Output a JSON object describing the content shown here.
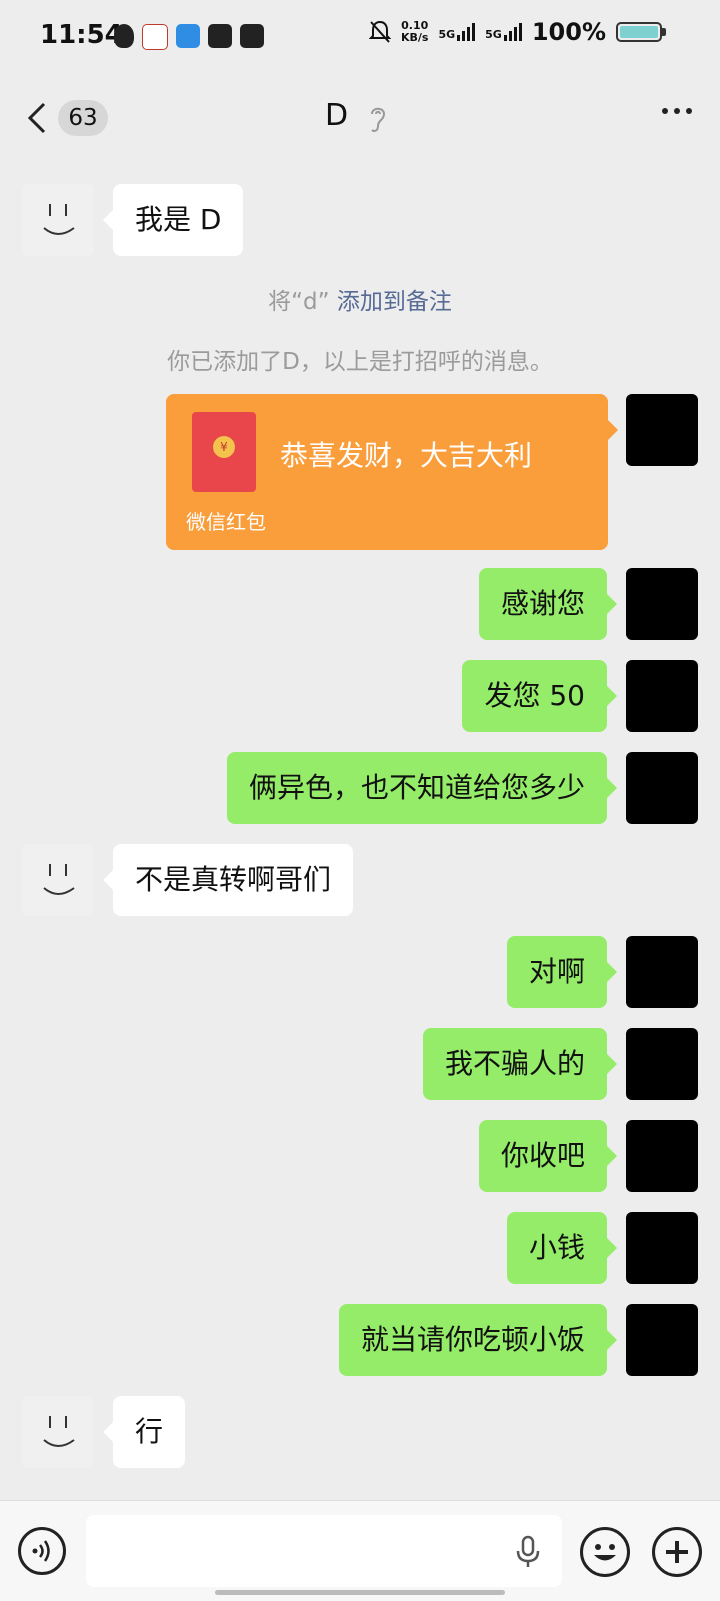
{
  "status_bar": {
    "time": "11:54",
    "net_speed_value": "0.10",
    "net_speed_unit": "KB/s",
    "sim1": "5G",
    "sim2": "5G",
    "battery": "100%"
  },
  "nav": {
    "unread_count": "63",
    "title": "D"
  },
  "messages": [
    {
      "from": "them",
      "text": "我是 D"
    },
    {
      "type": "system",
      "prefix": "将“d”",
      "link": "添加到备注"
    },
    {
      "type": "system",
      "text": "你已添加了D，以上是打招呼的消息。"
    },
    {
      "from": "me",
      "type": "red_packet",
      "title": "恭喜发财，大吉大利",
      "footer": "微信红包",
      "coin": "¥"
    },
    {
      "from": "me",
      "text": "感谢您"
    },
    {
      "from": "me",
      "text": "发您 50"
    },
    {
      "from": "me",
      "text": "俩异色，也不知道给您多少"
    },
    {
      "from": "them",
      "text": "不是真转啊哥们"
    },
    {
      "from": "me",
      "text": "对啊"
    },
    {
      "from": "me",
      "text": "我不骗人的"
    },
    {
      "from": "me",
      "text": "你收吧"
    },
    {
      "from": "me",
      "text": "小钱"
    },
    {
      "from": "me",
      "text": "就当请你吃顿小饭"
    },
    {
      "from": "them",
      "text": "行"
    }
  ],
  "input": {
    "value": "",
    "placeholder": ""
  },
  "icons": {
    "back": "chevron-left-icon",
    "ear": "ear-icon",
    "more": "more-dots-icon",
    "voice": "voice-icon",
    "mic": "mic-icon",
    "emoji": "emoji-icon",
    "plus": "plus-icon"
  },
  "colors": {
    "bubble_me": "#95ec69",
    "bubble_them": "#ffffff",
    "red_packet": "#fa9d3b",
    "link": "#576b95",
    "background": "#ededed"
  }
}
